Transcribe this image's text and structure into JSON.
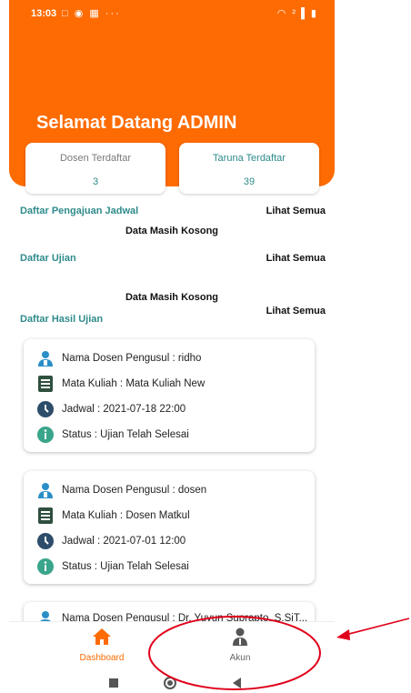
{
  "status_bar": {
    "time": "13:03",
    "left_icons": "□ ◉ ▦ ···",
    "right_icons": "◠ ²▐ ▮"
  },
  "header": {
    "welcome": "Selamat Datang ADMIN"
  },
  "stats": {
    "dosen": {
      "label": "Dosen Terdaftar",
      "value": "3"
    },
    "taruna": {
      "label": "Taruna Terdaftar",
      "value": "39"
    }
  },
  "sections": {
    "pengajuan": {
      "title": "Daftar Pengajuan Jadwal",
      "see_all": "Lihat Semua",
      "empty": "Data Masih Kosong"
    },
    "ujian": {
      "title": "Daftar Ujian",
      "see_all": "Lihat Semua",
      "empty": "Data Masih Kosong"
    },
    "hasil": {
      "title": "Daftar Hasil Ujian",
      "see_all": "Lihat Semua"
    }
  },
  "results": [
    {
      "dosen": "Nama Dosen Pengusul : ridho",
      "matkul": "Mata Kuliah : Mata Kuliah New",
      "jadwal": "Jadwal : 2021-07-18 22:00",
      "status": "Status : Ujian Telah Selesai"
    },
    {
      "dosen": "Nama Dosen Pengusul : dosen",
      "matkul": "Mata Kuliah : Dosen Matkul",
      "jadwal": "Jadwal : 2021-07-01 12:00",
      "status": "Status : Ujian Telah Selesai"
    },
    {
      "dosen": "Nama Dosen Pengusul : Dr. Yuyun Suprapto, S.SiT..."
    }
  ],
  "nav": {
    "dashboard": "Dashboard",
    "akun": "Akun"
  },
  "colors": {
    "brand": "#fe6b02",
    "teal": "#2f8b8b",
    "annotation": "#e0001a"
  },
  "icons": {
    "dosen": "person-icon",
    "matkul": "book-icon",
    "jadwal": "clock-icon",
    "status": "info-icon",
    "dashboard": "home-icon",
    "akun": "user-icon"
  }
}
